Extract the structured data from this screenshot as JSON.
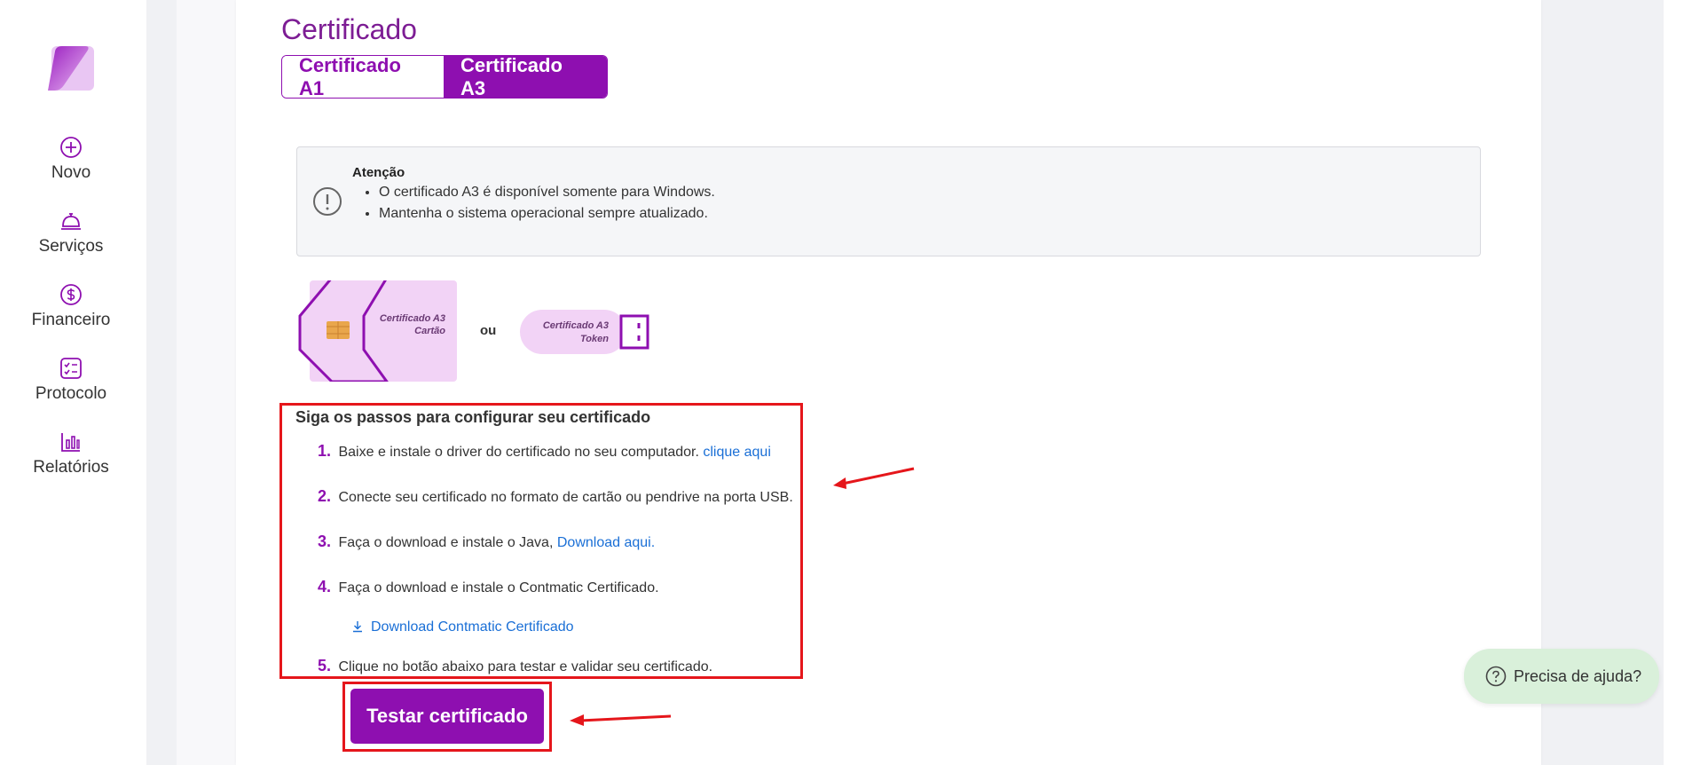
{
  "sidebar": {
    "items": [
      {
        "label": "Novo",
        "icon": "plus-circle-icon"
      },
      {
        "label": "Serviços",
        "icon": "bell-service-icon"
      },
      {
        "label": "Financeiro",
        "icon": "dollar-circle-icon"
      },
      {
        "label": "Protocolo",
        "icon": "checklist-icon"
      },
      {
        "label": "Relatórios",
        "icon": "bar-chart-icon"
      }
    ]
  },
  "page": {
    "title": "Certificado",
    "tabs": [
      {
        "label": "Certificado A1",
        "active": false
      },
      {
        "label": "Certificado A3",
        "active": true
      }
    ]
  },
  "alert": {
    "title": "Atenção",
    "items": [
      "O certificado A3 é disponível somente para Windows.",
      "Mantenha o sistema operacional sempre atualizado."
    ]
  },
  "illustrations": {
    "card_label_line1": "Certificado A3",
    "card_label_line2": "Cartão",
    "separator": "ou",
    "token_label_line1": "Certificado A3",
    "token_label_line2": "Token"
  },
  "steps": {
    "title": "Siga os passos para configurar seu certificado",
    "list": [
      {
        "num": "1.",
        "text": "Baixe e instale o driver do certificado no seu computador.",
        "link": "clique aqui"
      },
      {
        "num": "2.",
        "text": "Conecte seu certificado no formato de cartão ou pendrive na porta USB.",
        "link": ""
      },
      {
        "num": "3.",
        "text": "Faça o download e instale o Java,",
        "link": "Download aqui."
      },
      {
        "num": "4.",
        "text": "Faça o download e instale o Contmatic Certificado.",
        "link": ""
      },
      {
        "num": "5.",
        "text": "Clique no botão abaixo para testar e validar seu certificado.",
        "link": ""
      }
    ],
    "download_link": "Download Contmatic Certificado"
  },
  "actions": {
    "test_button": "Testar certificado"
  },
  "help": {
    "label": "Precisa de ajuda?"
  },
  "colors": {
    "brand": "#8e0fb0",
    "link": "#1a6fd6",
    "highlight": "#e5161b",
    "help_bg": "#d9f0da"
  }
}
